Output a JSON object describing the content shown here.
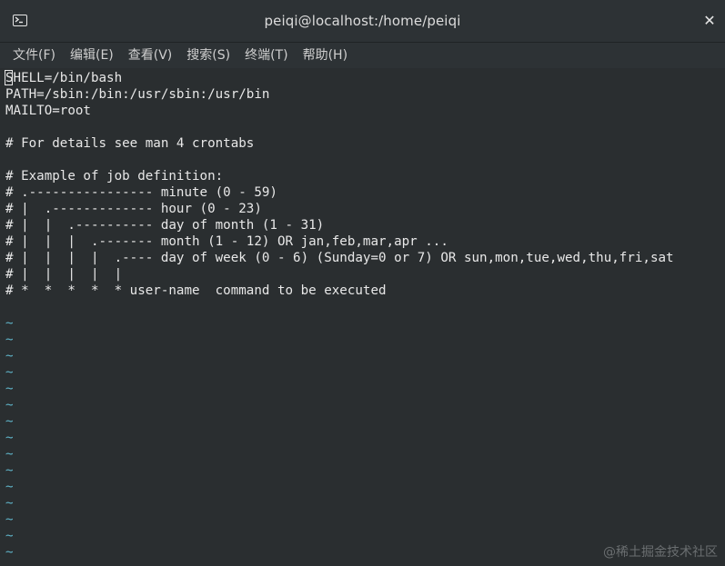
{
  "window": {
    "title": "peiqi@localhost:/home/peiqi"
  },
  "menu": [
    "文件(F)",
    "编辑(E)",
    "查看(V)",
    "搜索(S)",
    "终端(T)",
    "帮助(H)"
  ],
  "editor": {
    "lines": [
      "SHELL=/bin/bash",
      "PATH=/sbin:/bin:/usr/sbin:/usr/bin",
      "MAILTO=root",
      "",
      "# For details see man 4 crontabs",
      "",
      "# Example of job definition:",
      "# .---------------- minute (0 - 59)",
      "# |  .------------- hour (0 - 23)",
      "# |  |  .---------- day of month (1 - 31)",
      "# |  |  |  .------- month (1 - 12) OR jan,feb,mar,apr ...",
      "# |  |  |  |  .---- day of week (0 - 6) (Sunday=0 or 7) OR sun,mon,tue,wed,thu,fri,sat",
      "# |  |  |  |  |",
      "# *  *  *  *  * user-name  command to be executed",
      ""
    ],
    "tilde_lines": [
      "~",
      "~",
      "~",
      "~",
      "~",
      "~",
      "~",
      "~",
      "~",
      "~",
      "~",
      "~",
      "~",
      "~",
      "~"
    ]
  },
  "watermark": "@稀土掘金技术社区",
  "colors": {
    "background": "#2a2e30",
    "text": "#e8e8e8",
    "tilde": "#5fb3c8"
  }
}
